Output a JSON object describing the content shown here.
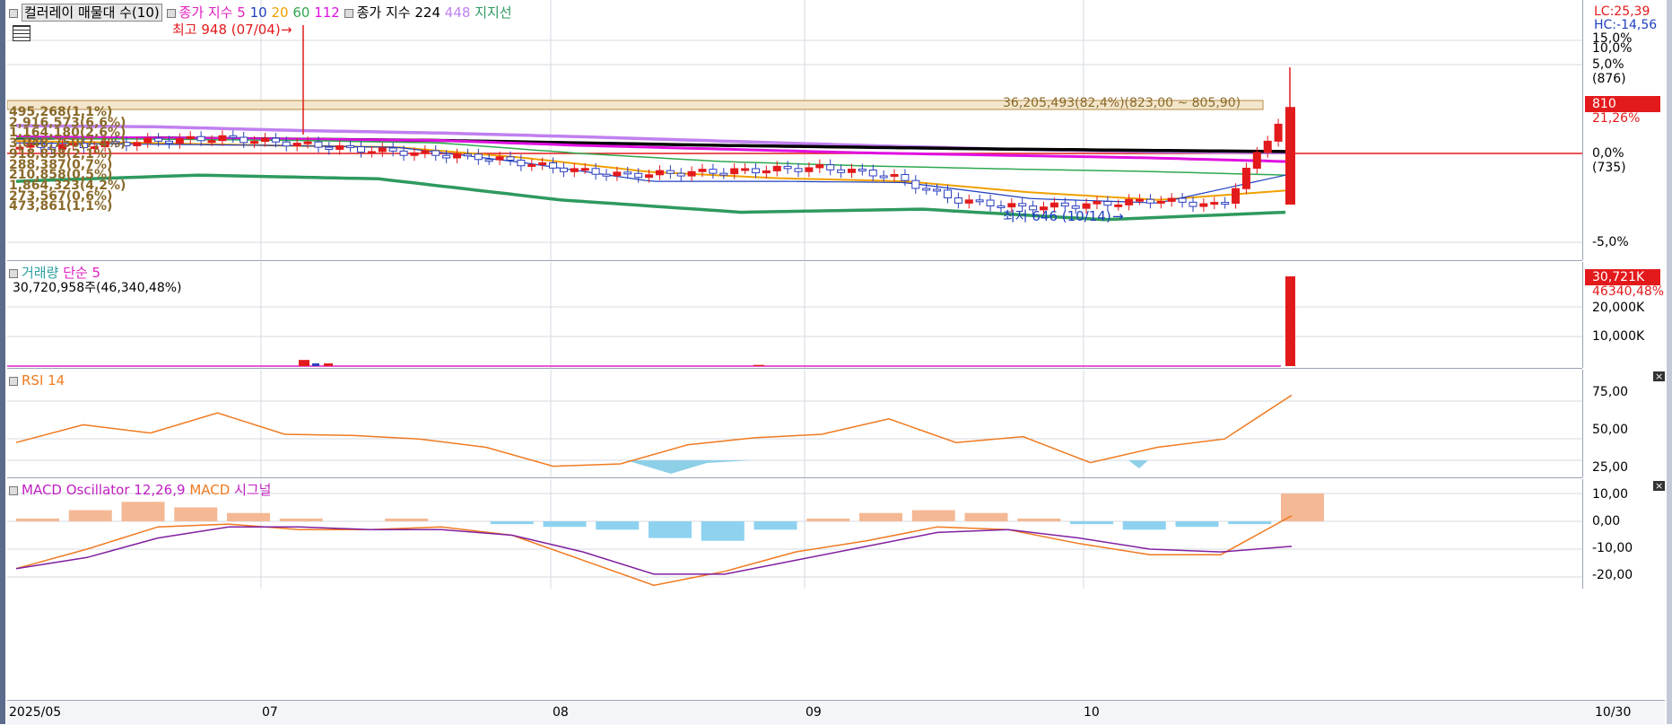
{
  "price_legend": {
    "title": "컬러레이 매물대 수(10)",
    "ma_label": "종가 지수 5",
    "ma_periods": [
      "10",
      "20",
      "60",
      "112"
    ],
    "ma_long_label": "종가 지수 224",
    "ma_long2": "448",
    "support": "지지선"
  },
  "annotations": {
    "high": "최고 948 (07/04)",
    "low": "최저 646 (10/14)",
    "volume_profile_top": "36,205,493(82,4%)(823,00 ~ 805,90)",
    "profile_labels": [
      "495,268(1,1%)",
      "2,916,573(6,6%)",
      "1,164,180(2,6%)",
      "3,048,750(7,4%)",
      "918,838(2,1%)",
      "288,387(0,7%)",
      "210,858(0,5%)",
      "1,864,323(4,2%)",
      "273,567(0,6%)",
      "473,861(1,1%)"
    ],
    "lc": "LC:25,39",
    "hc": "HC:-14,56"
  },
  "price_axis": {
    "ticks": [
      "15,0%",
      "10,0%",
      "5,0%",
      "(876)",
      "0,0%",
      "(735)",
      "-5,0%"
    ],
    "current_price": "810",
    "current_pct": "21,26%"
  },
  "volume_legend": {
    "title": "거래량",
    "ma": "단순 5",
    "value": "30,720,958주(46,340,48%)"
  },
  "volume_axis": {
    "ticks": [
      "20,000K",
      "10,000K"
    ],
    "current": "30,721K",
    "ma_current": "46340,48%"
  },
  "rsi_legend": {
    "title": "RSI 14"
  },
  "rsi_axis": {
    "ticks": [
      "75,00",
      "50,00",
      "25,00"
    ]
  },
  "macd_legend": {
    "osc": "MACD Oscillator 12,26,9",
    "macd": "MACD",
    "signal": "시그널"
  },
  "macd_axis": {
    "ticks": [
      "10,00",
      "0,00",
      "-10,00",
      "-20,00"
    ]
  },
  "x_axis": {
    "labels": [
      "2025/05",
      "07",
      "08",
      "09",
      "10"
    ],
    "end_label": "10/30"
  },
  "colors": {
    "up": "#e31a1c",
    "down": "#2c3ebd",
    "ma5": "#e020c0",
    "ma10": "#1f3fbf",
    "ma20": "#f0a000",
    "ma60": "#2fa84f",
    "ma112": "#e010e0",
    "ma224": "#000000",
    "ma448": "#c080f0",
    "support": "#2e9a5e",
    "rsi": "#f07a20",
    "macd": "#f07a20",
    "signal": "#8020a0"
  },
  "chart_data": [
    {
      "type": "line",
      "title": "컬러레이 매물대 수(10)",
      "x": [
        "2025/05",
        "07",
        "08",
        "09",
        "10",
        "10/30"
      ],
      "series": [
        {
          "name": "종가",
          "values": [
            745,
            760,
            742,
            700,
            712,
            648,
            660,
            810
          ]
        },
        {
          "name": "지지선",
          "values": [
            690,
            700,
            694,
            660,
            640,
            645,
            628,
            640
          ]
        }
      ],
      "points": {
        "high": 948,
        "low": 646,
        "last": 810
      }
    },
    {
      "type": "bar",
      "title": "거래량",
      "x": [
        "07",
        "08",
        "10/30"
      ],
      "series": [
        {
          "name": "거래량",
          "values": [
            2100,
            400,
            30721
          ]
        }
      ]
    },
    {
      "type": "line",
      "title": "RSI 14",
      "ylim": [
        25,
        75
      ],
      "series": [
        {
          "name": "RSI 14",
          "values": [
            40,
            55,
            48,
            65,
            47,
            46,
            43,
            36,
            20,
            22,
            38,
            44,
            47,
            60,
            40,
            45,
            23,
            36,
            43,
            80
          ]
        }
      ]
    },
    {
      "type": "bar",
      "title": "MACD Oscillator 12,26,9",
      "ylim": [
        -20,
        10
      ],
      "series": [
        {
          "name": "MACD Oscillator 12,26,9",
          "values": [
            1,
            4,
            7,
            5,
            3,
            1,
            0,
            1,
            0,
            -1,
            -2,
            -3,
            -6,
            -7,
            -3,
            1,
            3,
            4,
            3,
            1,
            -1,
            -3,
            -2,
            -1,
            10
          ]
        },
        {
          "name": "MACD",
          "values": [
            -17,
            -10,
            -2,
            -1,
            -3,
            -3,
            -2,
            -5,
            -14,
            -23,
            -18,
            -11,
            -7,
            -2,
            -3,
            -8,
            -12,
            -12,
            2
          ]
        },
        {
          "name": "시그널",
          "values": [
            -17,
            -13,
            -6,
            -2,
            -2,
            -3,
            -3,
            -5,
            -11,
            -19,
            -19,
            -14,
            -9,
            -4,
            -3,
            -6,
            -10,
            -11,
            -9
          ]
        }
      ]
    }
  ]
}
